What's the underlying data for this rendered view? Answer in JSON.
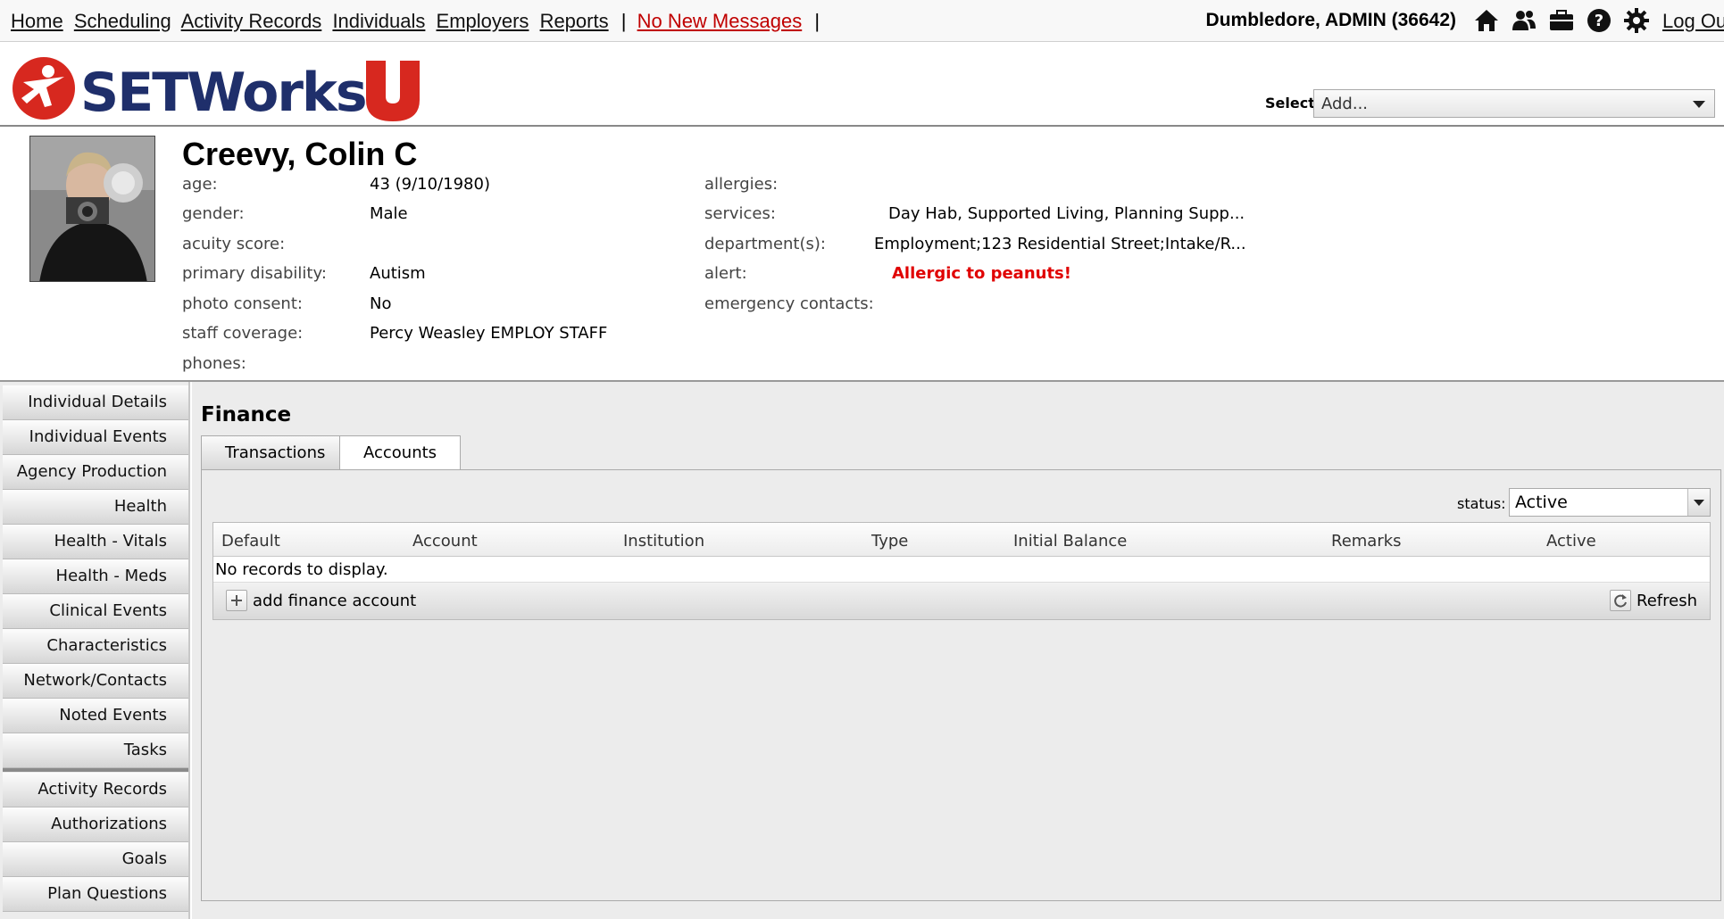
{
  "nav": {
    "links": [
      "Home",
      "Scheduling",
      "Activity Records",
      "Individuals",
      "Employers",
      "Reports"
    ],
    "separator": "|",
    "messages": "No New Messages",
    "user": "Dumbledore, ADMIN  (36642)",
    "icons": [
      "home-icon",
      "people-icon",
      "briefcase-icon",
      "help-icon",
      "gear-icon"
    ],
    "logout": "Log Out"
  },
  "brand": {
    "logo_text": "SETWorks",
    "logo_letter": "U",
    "select_label": "Select:",
    "select_value": "Add..."
  },
  "profile": {
    "name": "Creevy, Colin C",
    "left_fields": [
      {
        "label": "age:",
        "value": "43 (9/10/1980)"
      },
      {
        "label": "gender:",
        "value": "Male"
      },
      {
        "label": "acuity score:",
        "value": ""
      },
      {
        "label": "primary disability:",
        "value": "Autism"
      },
      {
        "label": "photo consent:",
        "value": "No"
      },
      {
        "label": "staff coverage:",
        "value": "Percy Weasley EMPLOY STAFF"
      },
      {
        "label": "phones:",
        "value": ""
      }
    ],
    "right_fields": [
      {
        "label": "allergies:",
        "value": ""
      },
      {
        "label": "services:",
        "value": "Day Hab, Supported Living, Planning Supp..."
      },
      {
        "label": "department(s):",
        "value": "Employment;123 Residential Street;Intake/R..."
      },
      {
        "label": "alert:",
        "value": "Allergic to peanuts!"
      },
      {
        "label": "emergency contacts:",
        "value": ""
      }
    ]
  },
  "sidebar": {
    "group1": [
      "Individual Details",
      "Individual Events",
      "Agency Production",
      "Health",
      "Health - Vitals",
      "Health - Meds",
      "Clinical Events",
      "Characteristics",
      "Network/Contacts",
      "Noted Events",
      "Tasks"
    ],
    "group2": [
      "Activity Records",
      "Authorizations",
      "Goals",
      "Plan Questions"
    ]
  },
  "finance": {
    "title": "Finance",
    "tabs": [
      "Transactions",
      "Accounts"
    ],
    "active_tab": "Accounts",
    "status_label": "status:",
    "status_value": "Active",
    "columns": [
      "Default",
      "Account",
      "Institution",
      "Type",
      "Initial Balance",
      "Remarks",
      "Active"
    ],
    "empty_text": "No records to display.",
    "add_label": "add finance account",
    "refresh_label": "Refresh"
  },
  "colors": {
    "brand_navy": "#1f2f6b",
    "brand_red": "#d7281f",
    "alert_red": "#e00000",
    "messages_red": "#c00000"
  }
}
